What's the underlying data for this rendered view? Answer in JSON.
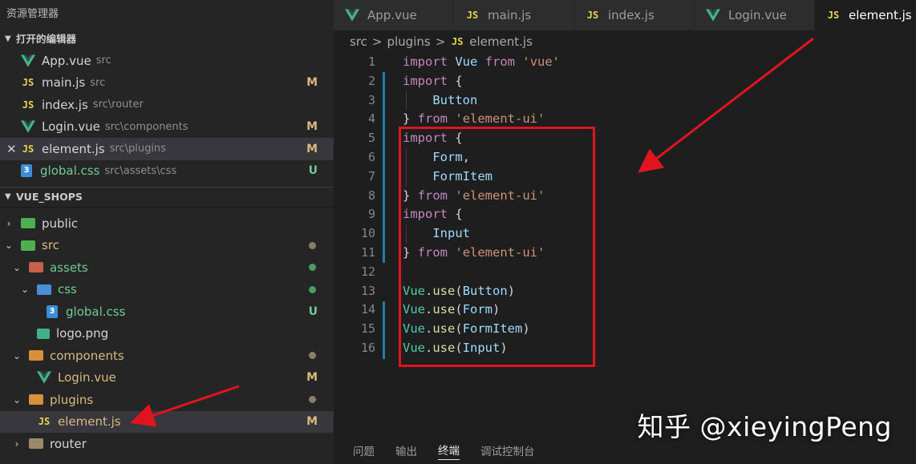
{
  "sidebar": {
    "title": "资源管理器",
    "open_editors_header": "打开的编辑器",
    "open_editors": [
      {
        "name": "App.vue",
        "path": "src",
        "icon": "vue-icon",
        "status": ""
      },
      {
        "name": "main.js",
        "path": "src",
        "icon": "js-icon",
        "status": "M"
      },
      {
        "name": "index.js",
        "path": "src\\router",
        "icon": "js-icon",
        "status": ""
      },
      {
        "name": "Login.vue",
        "path": "src\\components",
        "icon": "vue-icon",
        "status": "M"
      },
      {
        "name": "element.js",
        "path": "src\\plugins",
        "icon": "js-icon",
        "status": "M",
        "close": "✕"
      },
      {
        "name": "global.css",
        "path": "src\\assets\\css",
        "icon": "css-icon",
        "status": "U"
      }
    ],
    "project_header": "VUE_SHOPS",
    "tree": [
      {
        "name": "public"
      },
      {
        "name": "src"
      },
      {
        "name": "assets"
      },
      {
        "name": "css"
      },
      {
        "name": "global.css",
        "status": "U"
      },
      {
        "name": "logo.png"
      },
      {
        "name": "components"
      },
      {
        "name": "Login.vue",
        "status": "M"
      },
      {
        "name": "plugins"
      },
      {
        "name": "element.js",
        "status": "M"
      },
      {
        "name": "router"
      }
    ]
  },
  "tabs": [
    {
      "label": "App.vue",
      "icon": "vue-icon"
    },
    {
      "label": "main.js",
      "icon": "js-icon"
    },
    {
      "label": "index.js",
      "icon": "js-icon"
    },
    {
      "label": "Login.vue",
      "icon": "vue-icon"
    },
    {
      "label": "element.js",
      "icon": "js-icon",
      "active": true
    }
  ],
  "breadcrumb": {
    "part1": "src",
    "part2": "plugins",
    "part3": "element.js",
    "sep": ">"
  },
  "js_label": "JS",
  "css_label": "3",
  "code_lines": [
    "import Vue from 'vue'",
    "import {",
    "    Button",
    "} from 'element-ui'",
    "import {",
    "    Form,",
    "    FormItem",
    "} from 'element-ui'",
    "import {",
    "    Input",
    "} from 'element-ui'",
    "",
    "Vue.use(Button)",
    "Vue.use(Form)",
    "Vue.use(FormItem)",
    "Vue.use(Input)"
  ],
  "panel": {
    "problems": "问题",
    "output": "输出",
    "terminal": "终端",
    "debug_console": "调试控制台"
  },
  "watermark": "知乎 @xieyingPeng",
  "colors": {
    "accent_red": "#e0141e",
    "modified": "#d7ba7d",
    "untracked": "#73c991"
  }
}
